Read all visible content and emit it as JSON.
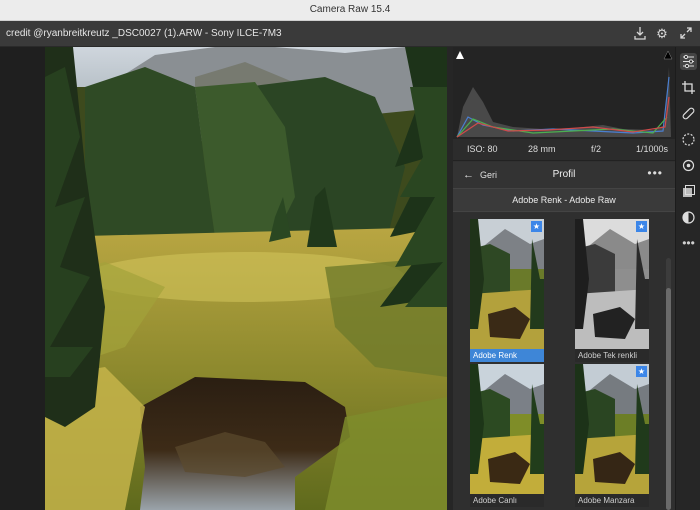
{
  "window": {
    "title": "Camera Raw 15.4"
  },
  "filebar": {
    "filename": "credit @ryanbreitkreutz _DSC0027 (1).ARW  -  Sony ILCE-7M3",
    "icons": [
      "save-icon",
      "gear-icon",
      "expand-icon"
    ]
  },
  "meta": {
    "iso": "ISO: 80",
    "focal": "28 mm",
    "aperture": "f/2",
    "shutter": "1/1000s"
  },
  "profile": {
    "back_label": "Geri",
    "title": "Profil",
    "more": "•••",
    "group": "Adobe Renk - Adobe Raw",
    "items": [
      {
        "label": "Adobe Renk",
        "selected": true,
        "starred": true
      },
      {
        "label": "Adobe Tek renkli",
        "selected": false,
        "starred": true
      },
      {
        "label": "Adobe Canlı",
        "selected": false,
        "starred": false
      },
      {
        "label": "Adobe Manzara",
        "selected": false,
        "starred": true
      }
    ]
  },
  "toolbar": [
    "edit-sliders-icon",
    "crop-icon",
    "healing-icon",
    "masking-icon",
    "redeye-icon",
    "snapshots-icon",
    "presets-icon",
    "more-icon"
  ],
  "colors": {
    "accent": "#3e86d7",
    "panel": "#303030",
    "toolbar": "#262626"
  }
}
